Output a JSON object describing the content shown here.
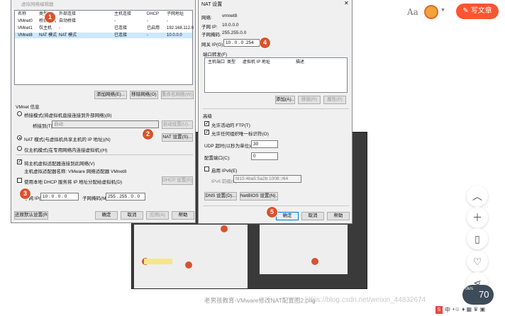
{
  "header": {
    "font_size_icon": "Aa",
    "write_button": "写文章"
  },
  "vne": {
    "title": "虚拟网络编辑器",
    "columns": [
      "名称",
      "类型",
      "外部连接",
      "主机连接",
      "DHCP",
      "子网地址"
    ],
    "rows": [
      {
        "name": "VMnet0",
        "type": "桥接模式",
        "ext": "自动桥接",
        "host": "-",
        "dhcp": "-",
        "subnet": "-"
      },
      {
        "name": "VMnet1",
        "type": "仅主机",
        "ext": "-",
        "host": "已连接",
        "dhcp": "已启用",
        "subnet": "192.168.112.0"
      },
      {
        "name": "VMnet8",
        "type": "NAT 模式",
        "ext": "NAT 模式",
        "host": "已连接",
        "dhcp": "-",
        "subnet": "10.0.0.0"
      }
    ],
    "add_network": "添加网络(E)...",
    "remove_network": "移除网络(O)",
    "rename_network": "重命名网络(W)...",
    "vmnet_info": "VMnet 信息",
    "bridge_mode": "桥接模式(将虚拟机直接连接到外部网络)(B)",
    "bridged_to": "桥接到(T):",
    "bridged_value": "自动",
    "auto_settings": "自动设置(U)...",
    "nat_mode": "NAT 模式(与虚拟机共享主机的 IP 地址)(N)",
    "nat_settings": "NAT 设置(S)...",
    "host_only": "仅主机模式(在专用网络内连接虚拟机)(H)",
    "connect_adapter": "将主机虚拟适配器连接到此网络(V)",
    "adapter_name": "主机虚拟适配器名称: VMware 网络适配器 VMnet8",
    "use_dhcp": "使用本地 DHCP 服务将 IP 地址分配给虚拟机(D)",
    "dhcp_settings": "DHCP 设置(P)...",
    "subnet_ip_label": "子网 IP(I):",
    "subnet_ip": "10 . 0 . 0 . 0",
    "subnet_mask_label": "子网掩码(M):",
    "subnet_mask": "255 . 255 . 0 . 0",
    "restore_defaults": "还原默认设置(R)",
    "ok": "确定",
    "cancel": "取消",
    "apply": "应用(A)",
    "help": "帮助"
  },
  "nat": {
    "title": "NAT 设置",
    "network_label": "网络:",
    "network": "vmnet8",
    "subnet_ip_label": "子网 IP:",
    "subnet_ip": "10.0.0.0",
    "subnet_mask_label": "子网掩码:",
    "subnet_mask": "255.255.0.0",
    "gateway_label": "网关 IP(G):",
    "gateway": "10 . 0 . 0 .254",
    "port_forward": "端口转发(F)",
    "pf_columns": [
      "主机端口",
      "类型",
      "虚拟机 IP 地址",
      "描述"
    ],
    "add": "添加(A)...",
    "remove": "移除(R)",
    "properties": "属性(P)",
    "advanced": "高级",
    "allow_ftp": "允许活动的 FTP(T)",
    "allow_uuid": "允许任何组织唯一标识符(O)",
    "udp_timeout_label": "UDP 超时(以秒为单位)(U):",
    "udp_timeout": "30",
    "config_port_label": "配置端口(C):",
    "config_port": "0",
    "enable_ipv6": "启用 IPv6(E)",
    "ipv6_prefix_label": "IPv6 前缀(6):",
    "ipv6_prefix": "fd15:4ba5:5a2b:1008::/64",
    "dns": "DNS 设置(D)...",
    "netbios": "NetBIOS 设置(N)...",
    "ok": "确定",
    "cancel": "取消",
    "help": "帮助"
  },
  "badges": [
    "1",
    "2",
    "3",
    "4",
    "5"
  ],
  "caption": "老男孩教育-VMware修改NAT配置图2.png",
  "watermark": "https://blog.csdn.net/weixin_44832674",
  "sidebar": {
    "speed": "70",
    "speed_unit": "0k/s"
  },
  "ime": "中"
}
